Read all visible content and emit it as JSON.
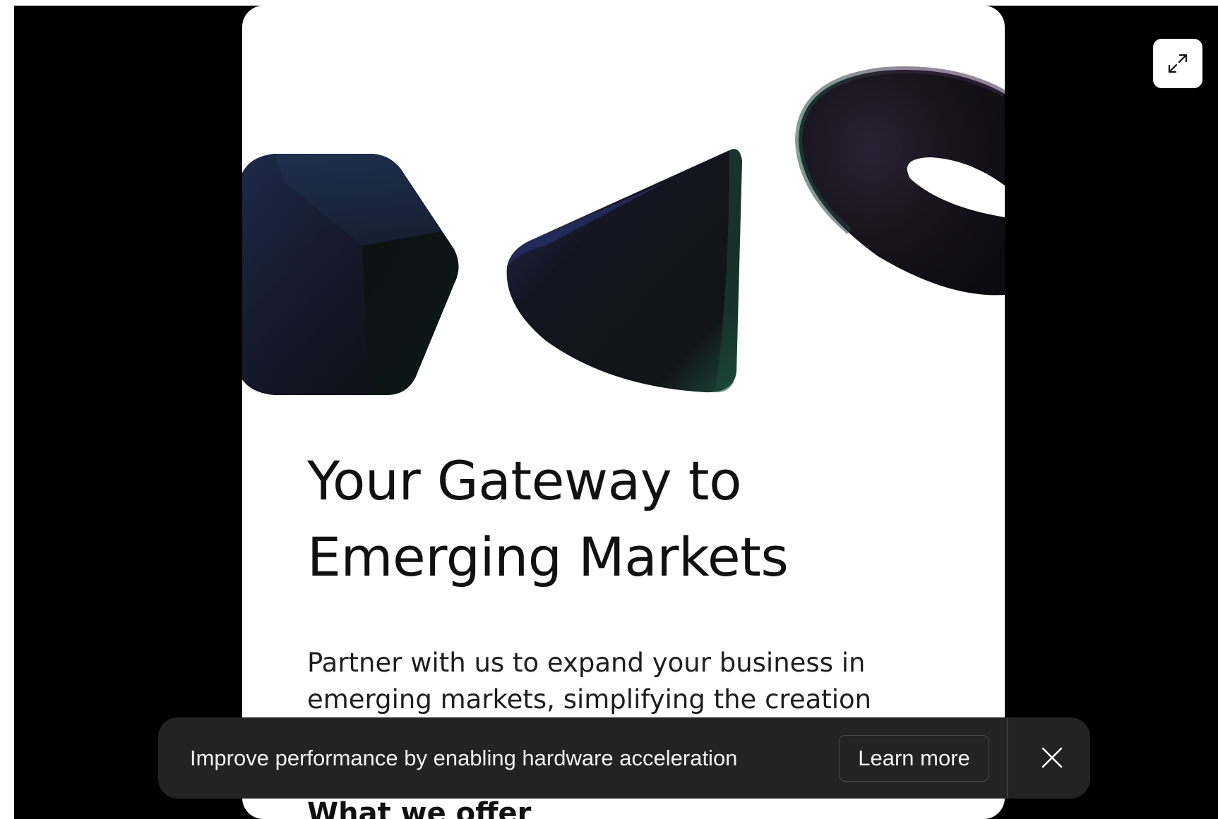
{
  "hero": {
    "title_line1": "Your Gateway to",
    "title_line2": "Emerging Markets",
    "desc_line1": "Partner with us to expand your business in",
    "desc_line2": "emerging markets, simplifying the creation",
    "section_heading": "What we offer"
  },
  "viewer": {
    "expand_icon": "expand-diagonal-icon"
  },
  "toast": {
    "message": "Improve performance by enabling hardware acceleration",
    "learn_more_label": "Learn more",
    "close_icon": "close-icon"
  },
  "colors": {
    "backdrop": "#000000",
    "card": "#ffffff",
    "toast_bg": "#232323",
    "shape_dark": "#0f0f12",
    "shape_navy_tint": "#1d2a4a",
    "shape_green_tint": "#1c4b3b",
    "shape_purple_tint": "#3a2748"
  }
}
